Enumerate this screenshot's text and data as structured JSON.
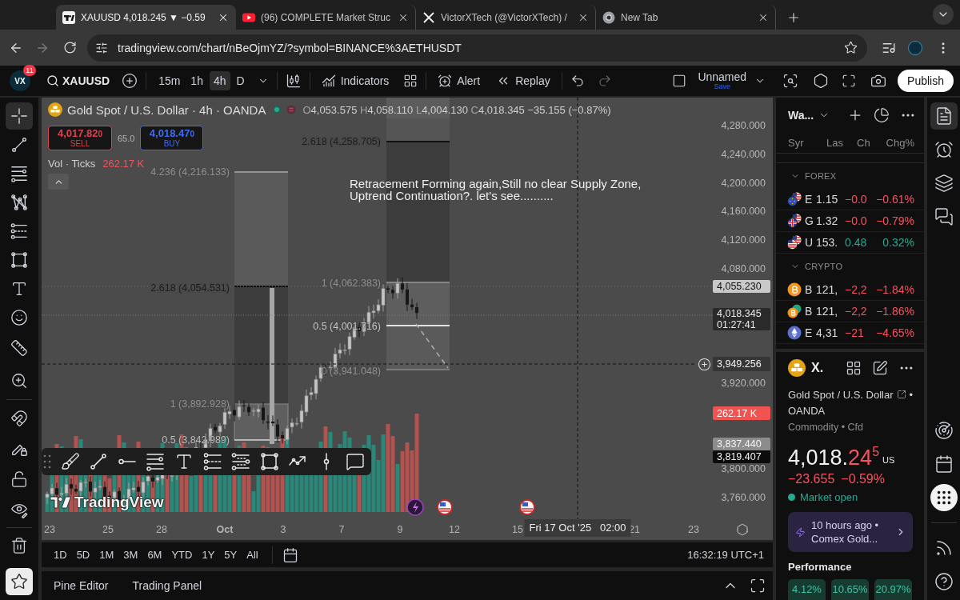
{
  "browser": {
    "tabs": [
      {
        "title": "XAUUSD 4,018.245 ▼ −0.59",
        "selected": true
      },
      {
        "title": "(96) COMPLETE Market Struc",
        "selected": false
      },
      {
        "title": "VictorXTech (@VictorXTech) /",
        "selected": false
      },
      {
        "title": "New Tab",
        "selected": false
      }
    ],
    "url": "tradingview.com/chart/nBeOjmYZ/?symbol=BINANCE%3AETHUSDT"
  },
  "toolbar": {
    "avatar": "VX",
    "badge": "11",
    "symbol": "XAUUSD",
    "intervals": [
      {
        "label": "15m",
        "selected": false
      },
      {
        "label": "1h",
        "selected": false
      },
      {
        "label": "4h",
        "selected": true
      },
      {
        "label": "D",
        "selected": false
      }
    ],
    "indicators": "Indicators",
    "alert": "Alert",
    "replay": "Replay",
    "layout": "Unnamed",
    "save": "Save",
    "publish": "Publish"
  },
  "left_tools": [
    {
      "selected": true
    },
    {
      "selected": false
    },
    {
      "selected": false
    },
    {
      "selected": false
    },
    {
      "selected": false
    },
    {
      "selected": false
    },
    {
      "selected": false
    },
    {
      "selected": false
    },
    {
      "selected": false
    },
    {
      "selected": false
    },
    {
      "selected": false
    },
    {
      "selected": false
    },
    {
      "selected": false
    },
    {
      "selected": false
    },
    {
      "selected": false
    }
  ],
  "favorites": {
    "on": true
  },
  "legend": {
    "title": "Gold Spot / U.S. Dollar · 4h · OANDA",
    "ohlc": [
      {
        "key": "O",
        "value": "4,053.575"
      },
      {
        "key": "H",
        "value": "4,058.110"
      },
      {
        "key": "L",
        "value": "4,004.130"
      },
      {
        "key": "C",
        "value": "4,018.345"
      }
    ],
    "change": "−35.155 (−0.87%)",
    "sell": {
      "price": "4,017.82",
      "pip": "0",
      "label": "SELL"
    },
    "spread": "65.0",
    "buy": {
      "price": "4,018.47",
      "pip": "0",
      "label": "BUY"
    },
    "volume_label": "Vol · Ticks",
    "volume_value": "262.17 K"
  },
  "chart": {
    "fib_labels": [
      "4.236 (4,216.133)",
      "2.618 (4,054.531)",
      "1 (3,892.928)",
      "0.5 (3,842.989)",
      "2.618 (4,258.705)",
      "1 (4,062.383)",
      "0.5 (4,001.716)",
      "0 (3,941.048)"
    ],
    "note": "Retracement Forming again,Still no clear Supply Zone,\nUptrend Continuation?. let's see..........",
    "logo": "TradingView",
    "price_axis": [
      "4,280.000",
      "4,240.000",
      "4,200.000",
      "4,160.000",
      "4,120.000",
      "4,080.000",
      "3,920.000",
      "3,800.000",
      "3,760.000"
    ],
    "price_tags": [
      {
        "kind": "marker",
        "text": "4,055.230"
      },
      {
        "kind": "last",
        "text": "4,018.345",
        "countdown": "01:27:41"
      },
      {
        "kind": "crosshair",
        "text": "3,949.256"
      },
      {
        "kind": "volume",
        "text": "262.17 K"
      },
      {
        "kind": "marker-dim",
        "text": "3,837.440"
      },
      {
        "kind": "marker-dark",
        "text": "3,819.407"
      }
    ],
    "time_axis": [
      {
        "text": "23",
        "kind": "day"
      },
      {
        "text": "25",
        "kind": "day"
      },
      {
        "text": "28",
        "kind": "day"
      },
      {
        "text": "Oct",
        "kind": "month"
      },
      {
        "text": "3",
        "kind": "day"
      },
      {
        "text": "7",
        "kind": "day"
      },
      {
        "text": "9",
        "kind": "day"
      },
      {
        "text": "12",
        "kind": "day"
      },
      {
        "text": "15",
        "kind": "day"
      },
      {
        "text": "21",
        "kind": "day"
      },
      {
        "text": "23",
        "kind": "day"
      }
    ],
    "crosshair_time": "Fri 17 Oct '25   02:00"
  },
  "ranges": [
    "1D",
    "5D",
    "1M",
    "3M",
    "6M",
    "YTD",
    "1Y",
    "5Y",
    "All"
  ],
  "clock": "16:32:19 UTC+1",
  "bottom_tabs": [
    "Pine Editor",
    "Trading Panel"
  ],
  "watchlist": {
    "title": "Wa...",
    "columns": [
      "Syr",
      "Las",
      "Ch",
      "Chg%"
    ],
    "sections": [
      {
        "name": "FOREX",
        "expanded": true,
        "rows": [
          {
            "symbol": "E",
            "last": "1.15",
            "change": "−0.0",
            "change_pct": "−0.61%",
            "negative": true
          },
          {
            "symbol": "G",
            "last": "1.32",
            "change": "−0.0",
            "change_pct": "−0.79%",
            "negative": true
          },
          {
            "symbol": "U",
            "last": "153.",
            "change": "0.48",
            "change_pct": "0.32%",
            "negative": false
          }
        ]
      },
      {
        "name": "CRYPTO",
        "expanded": true,
        "rows": [
          {
            "symbol": "B",
            "last": "121,",
            "change": "−2,2",
            "change_pct": "−1.84%",
            "negative": true
          },
          {
            "symbol": "B",
            "last": "121,",
            "change": "−2,2",
            "change_pct": "−1.86%",
            "negative": true
          },
          {
            "symbol": "E",
            "last": "4,31",
            "change": "−21",
            "change_pct": "−4.65%",
            "negative": true
          }
        ]
      }
    ]
  },
  "symbol_detail": {
    "ticker": "X.",
    "name": "Gold Spot / U.S. Dollar",
    "separator": "•",
    "exchange": "OANDA",
    "category": "Commodity • Cfd",
    "price_int": "4,018.",
    "price_dec": "24",
    "price_pip": "5",
    "currency": "US",
    "change": "−23.655",
    "change_pct": "−0.59%",
    "negative": true,
    "status": "Market open",
    "market_open": true,
    "news": {
      "time": "10 hours ago •",
      "headline": "Comex Gold..."
    },
    "performance_title": "Performance",
    "performance": [
      "4.12%",
      "10.65%",
      "20.97%"
    ]
  },
  "right_bar": [
    {
      "selected": true
    },
    {
      "selected": false
    },
    {
      "selected": false
    },
    {
      "selected": false
    },
    {
      "selected": false
    },
    {
      "selected": false
    },
    {
      "selected": false
    },
    {
      "selected": false
    },
    {
      "selected": false
    }
  ]
}
